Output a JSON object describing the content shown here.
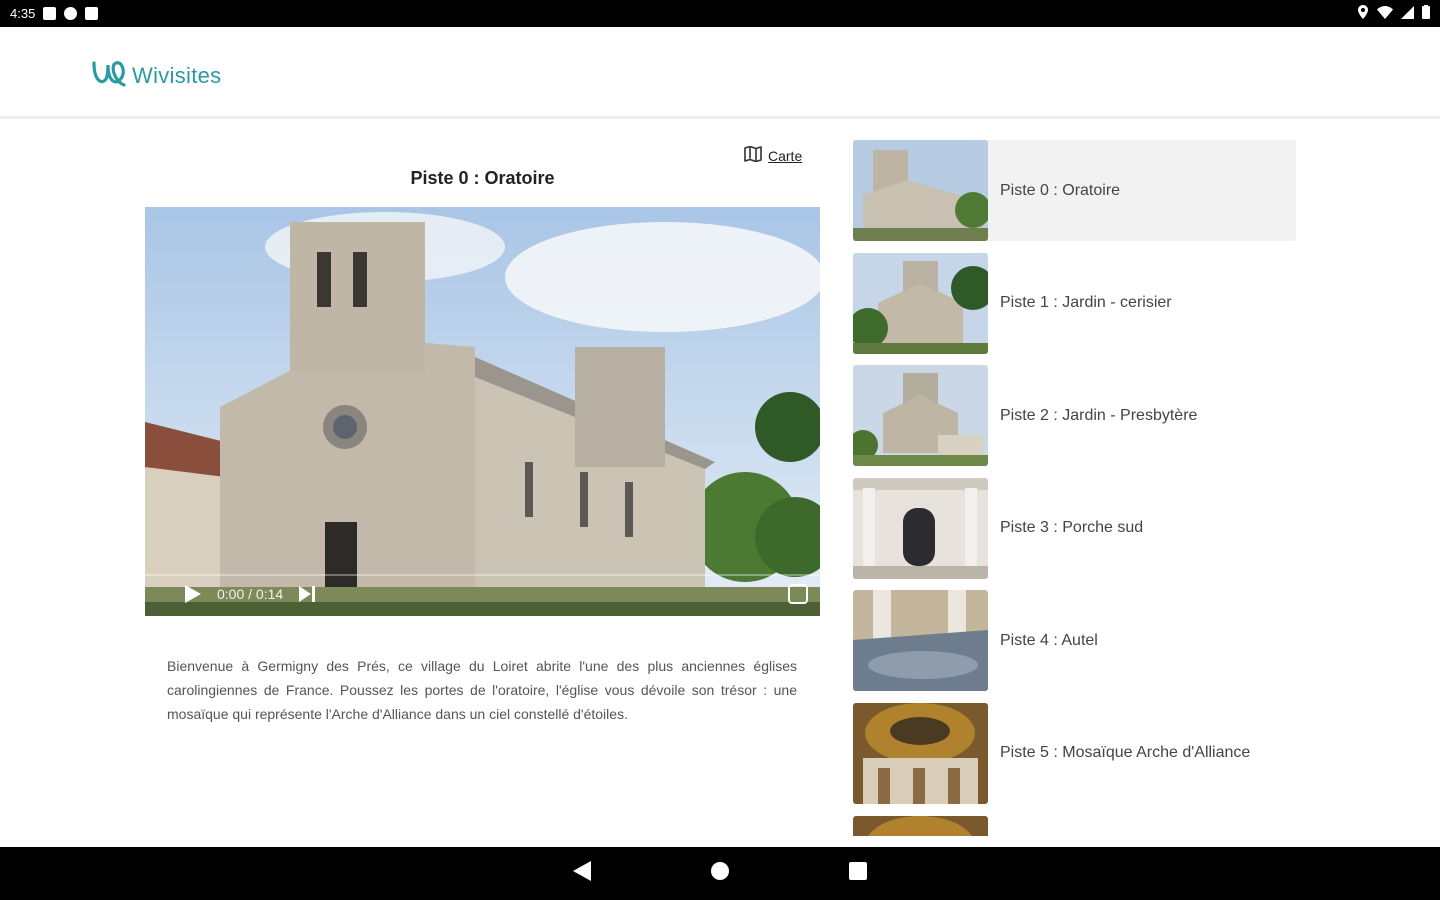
{
  "status_bar": {
    "time": "4:35"
  },
  "app": {
    "name": "Wivisites",
    "brand_color": "#2a9aa3"
  },
  "player": {
    "title": "Piste 0 : Oratoire",
    "map_link": "Carte",
    "time": "0:00 / 0:14",
    "description": "Bienvenue à Germigny des Prés, ce village du Loiret abrite l'une des plus anciennes églises carolingiennes de France. Poussez les portes de l'oratoire, l'église vous dévoile son trésor : une mosaïque qui représente l'Arche d'Alliance dans un ciel constellé d'étoiles."
  },
  "tracks": [
    {
      "label": "Piste 0 : Oratoire",
      "active": true
    },
    {
      "label": "Piste 1 : Jardin - cerisier",
      "active": false
    },
    {
      "label": "Piste 2 : Jardin - Presbytère",
      "active": false
    },
    {
      "label": "Piste 3 : Porche sud",
      "active": false
    },
    {
      "label": "Piste 4 : Autel",
      "active": false
    },
    {
      "label": "Piste 5 : Mosaïque Arche d'Alliance",
      "active": false
    }
  ]
}
